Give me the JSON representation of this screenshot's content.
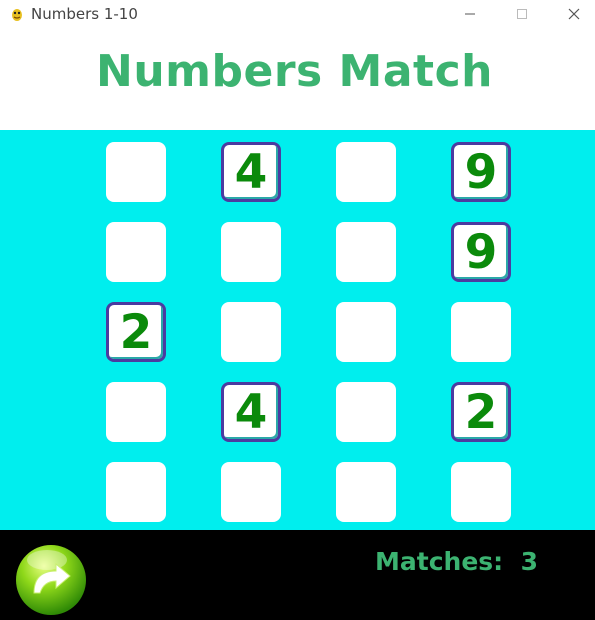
{
  "window": {
    "title": "Numbers 1-10",
    "minimize_glyph": "–",
    "maximize_glyph": "☐",
    "close_glyph": "✕"
  },
  "game": {
    "title": "Numbers Match"
  },
  "board": {
    "columns": 4,
    "rows": 5,
    "cards": [
      [
        null,
        "4",
        null,
        "9"
      ],
      [
        null,
        null,
        null,
        "9"
      ],
      [
        "2",
        null,
        null,
        null
      ],
      [
        null,
        "4",
        null,
        "2"
      ],
      [
        null,
        null,
        null,
        null
      ]
    ]
  },
  "footer": {
    "matches_label": "Matches:",
    "matches_count": 3,
    "restart_icon": "restart-arrow-icon"
  },
  "colors": {
    "board_bg": "#00eeee",
    "title_green": "#3cb371",
    "number_green": "#0b8a0b",
    "card_border": "#4b3ba0",
    "footer_bg": "#000000"
  }
}
